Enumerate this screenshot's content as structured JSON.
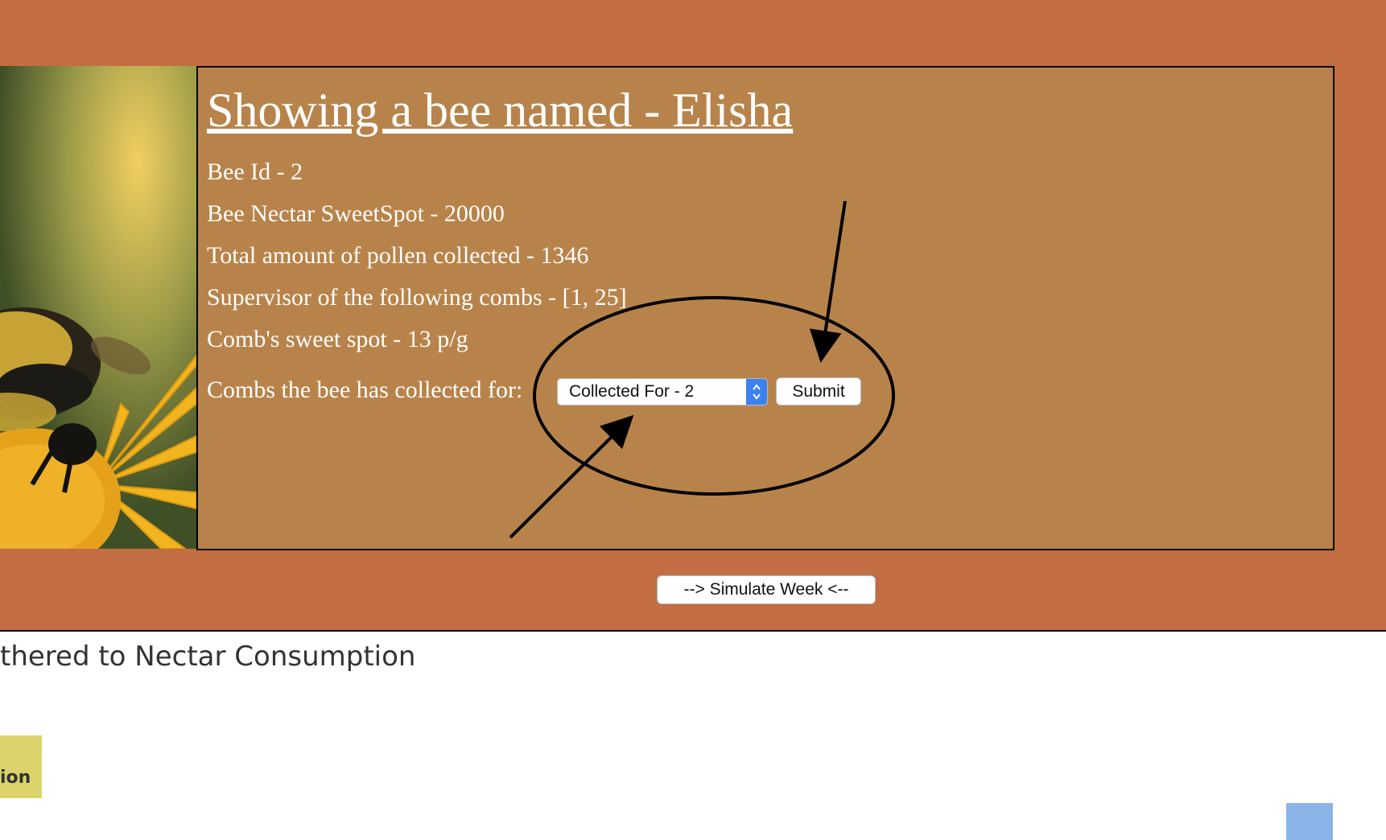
{
  "bee_card": {
    "title": "Showing a bee named - Elisha",
    "lines": [
      "Bee Id - 2",
      "Bee Nectar SweetSpot - 20000",
      "Total amount of pollen collected - 1346",
      "Supervisor of the following combs - [1, 25]",
      "Comb's sweet spot - 13 p/g"
    ],
    "combs_label": "Combs the bee has collected for:",
    "combs_select_value": "Collected For - 2",
    "submit_label": "Submit"
  },
  "simulate_label": "--> Simulate Week <--",
  "section_heading": "thered to Nectar Consumption",
  "legend_chip_label": "ion",
  "colors": {
    "page_band": "#c26e42",
    "panel": "#b8834a",
    "select_arrow": "#3b82f0",
    "legend_chip": "#dcd36c",
    "blue_block": "#8ab4e8"
  },
  "icons": {
    "select_arrows": "up-down-chevron-icon"
  }
}
